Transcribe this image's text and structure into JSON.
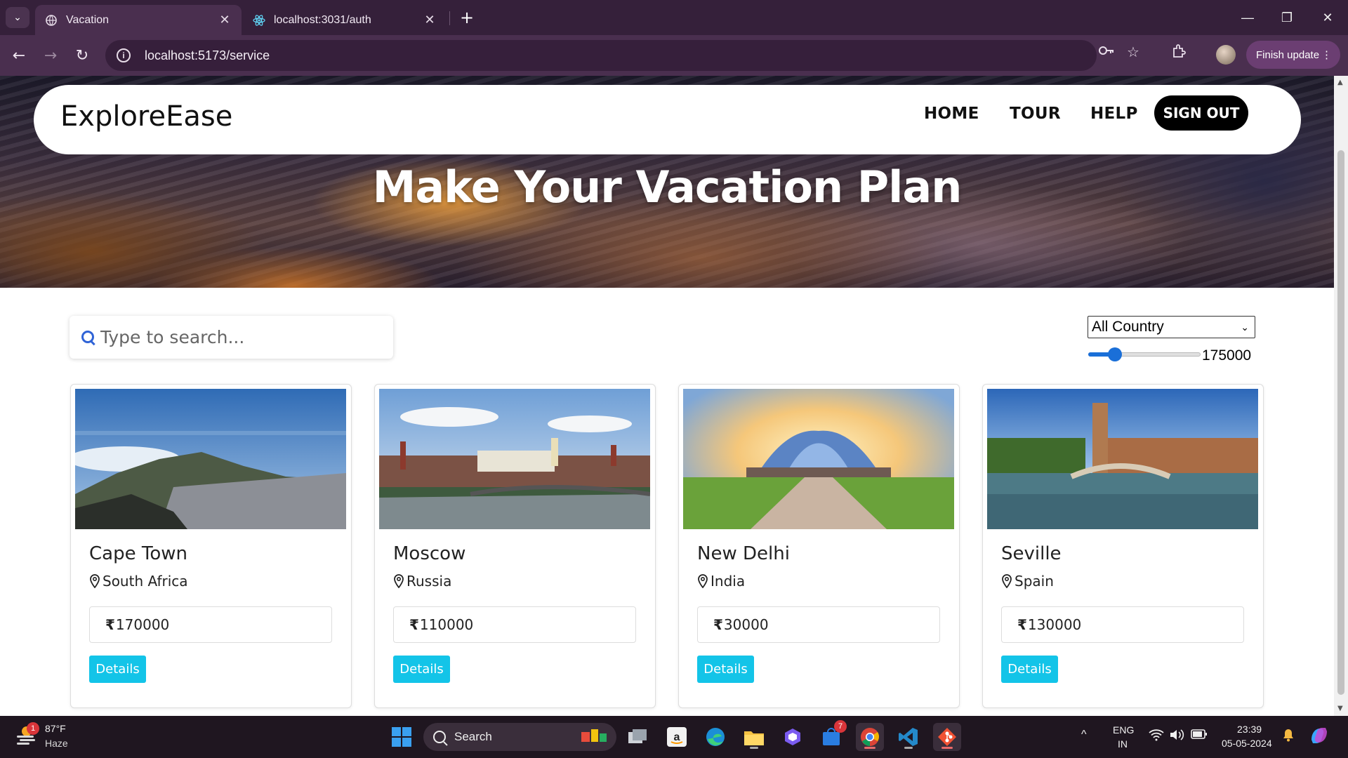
{
  "browser": {
    "tabs": [
      {
        "title": "Vacation",
        "active": true,
        "icon": "globe-icon"
      },
      {
        "title": "localhost:3031/auth",
        "active": false,
        "icon": "react-icon"
      }
    ],
    "url": "localhost:5173/service",
    "finish_update_label": "Finish update"
  },
  "site": {
    "brand": "ExploreEase",
    "nav": [
      "HOME",
      "TOUR",
      "HELP"
    ],
    "signout_label": "SIGN OUT",
    "hero_title": "Make Your Vacation Plan"
  },
  "filters": {
    "search_placeholder": "Type to search...",
    "country_selected": "All Country",
    "price_value": "175000",
    "price_slider_fraction": 0.2
  },
  "destinations": [
    {
      "city": "Cape Town",
      "country": "South Africa",
      "price": "170000",
      "details_label": "Details"
    },
    {
      "city": "Moscow",
      "country": "Russia",
      "price": "110000",
      "details_label": "Details"
    },
    {
      "city": "New Delhi",
      "country": "India",
      "price": "30000",
      "details_label": "Details"
    },
    {
      "city": "Seville",
      "country": "Spain",
      "price": "130000",
      "details_label": "Details"
    }
  ],
  "currency_symbol": "₹",
  "taskbar": {
    "weather_temp": "87°F",
    "weather_cond": "Haze",
    "weather_badge": "1",
    "search_label": "Search",
    "teams_badge": "7",
    "lang_top": "ENG",
    "lang_bottom": "IN",
    "time": "23:39",
    "date": "05-05-2024"
  },
  "colors": {
    "details_button": "#13c4e8",
    "browser_frame": "#35203a",
    "search_icon": "#2f63d6"
  }
}
